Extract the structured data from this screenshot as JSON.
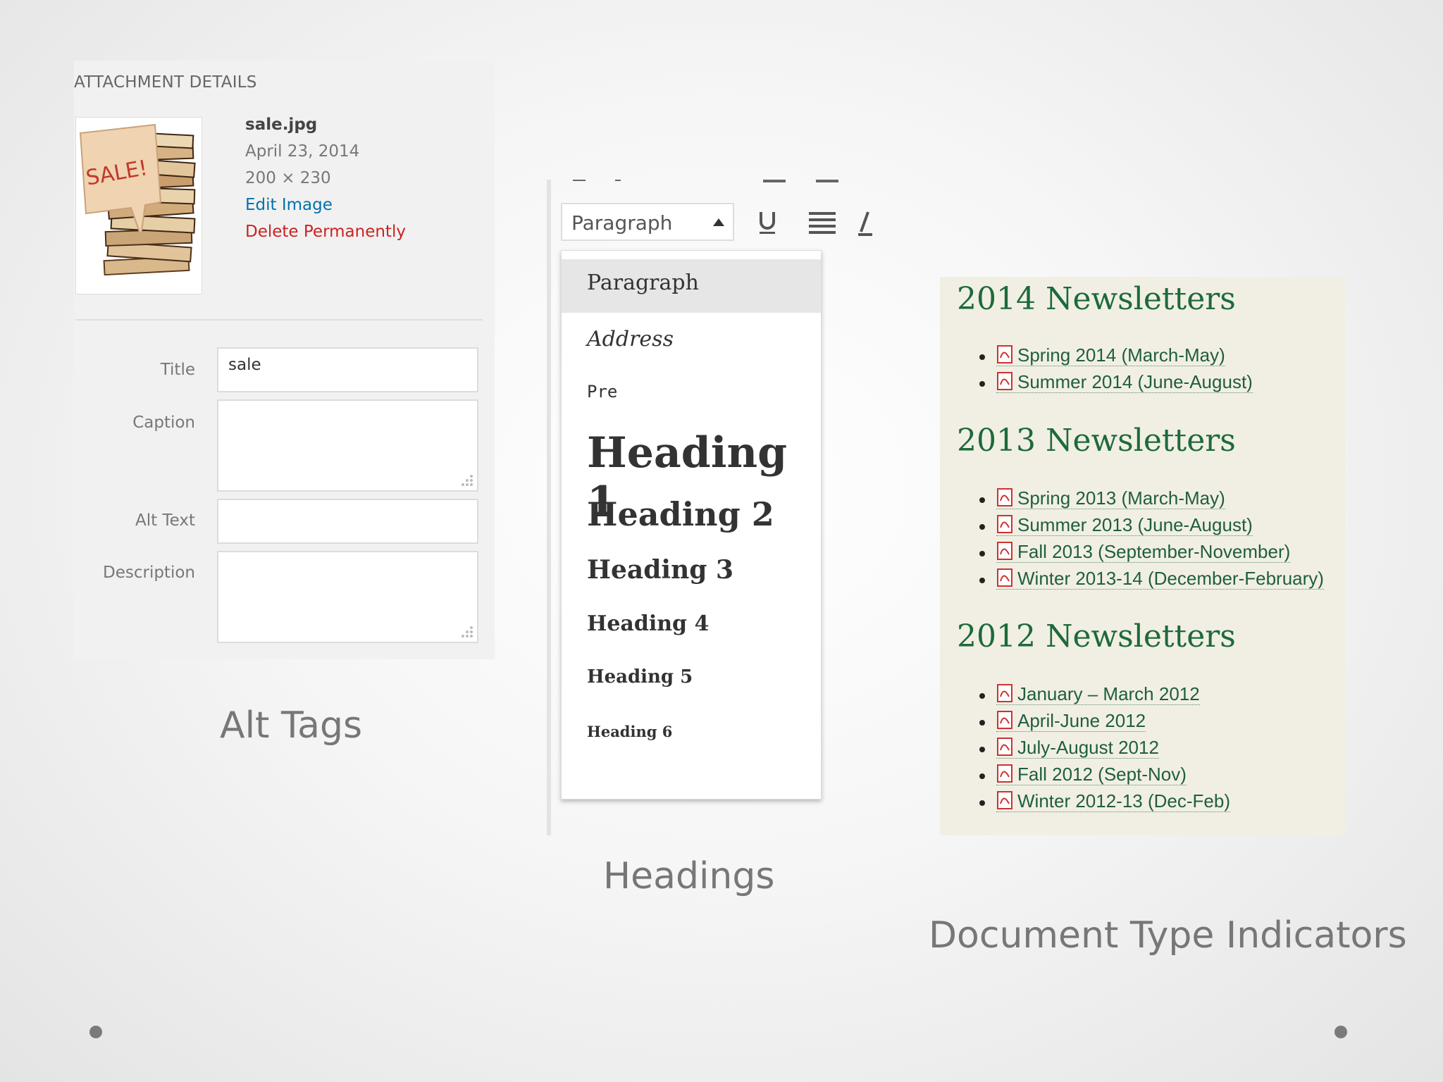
{
  "attachment": {
    "header": "ATTACHMENT DETAILS",
    "file_name": "sale.jpg",
    "date": "April 23, 2014",
    "dimensions": "200 × 230",
    "edit_link": "Edit Image",
    "delete_link": "Delete Permanently",
    "thumbnail_label": "SALE!",
    "fields": {
      "title_label": "Title",
      "title_value": "sale",
      "caption_label": "Caption",
      "alt_label": "Alt Text",
      "description_label": "Description"
    }
  },
  "editor": {
    "format_select_value": "Paragraph",
    "menu_items": [
      "Paragraph",
      "Address",
      "Pre",
      "Heading 1",
      "Heading 2",
      "Heading 3",
      "Heading 4",
      "Heading 5",
      "Heading 6"
    ],
    "selected": "Paragraph"
  },
  "newsletters": {
    "sections": [
      {
        "title": "2014 Newsletters",
        "items": [
          "Spring 2014 (March-May)",
          "Summer 2014 (June-August)"
        ]
      },
      {
        "title": "2013 Newsletters",
        "items": [
          "Spring 2013 (March-May)",
          "Summer 2013 (June-August)",
          "Fall 2013 (September-November)",
          "Winter 2013-14 (December-February)"
        ]
      },
      {
        "title": "2012 Newsletters",
        "items": [
          "January – March 2012",
          "April-June 2012",
          "July-August 2012",
          "Fall 2012 (Sept-Nov)",
          "Winter 2012-13 (Dec-Feb)"
        ]
      }
    ],
    "icon": "pdf-icon"
  },
  "captions": {
    "alt_tags": "Alt Tags",
    "headings": "Headings",
    "doc_types": "Document Type Indicators"
  },
  "colors": {
    "link_green": "#1f5e3f",
    "heading_green": "#1d6a3a",
    "delete_red": "#cc2222",
    "edit_blue": "#0073aa"
  }
}
